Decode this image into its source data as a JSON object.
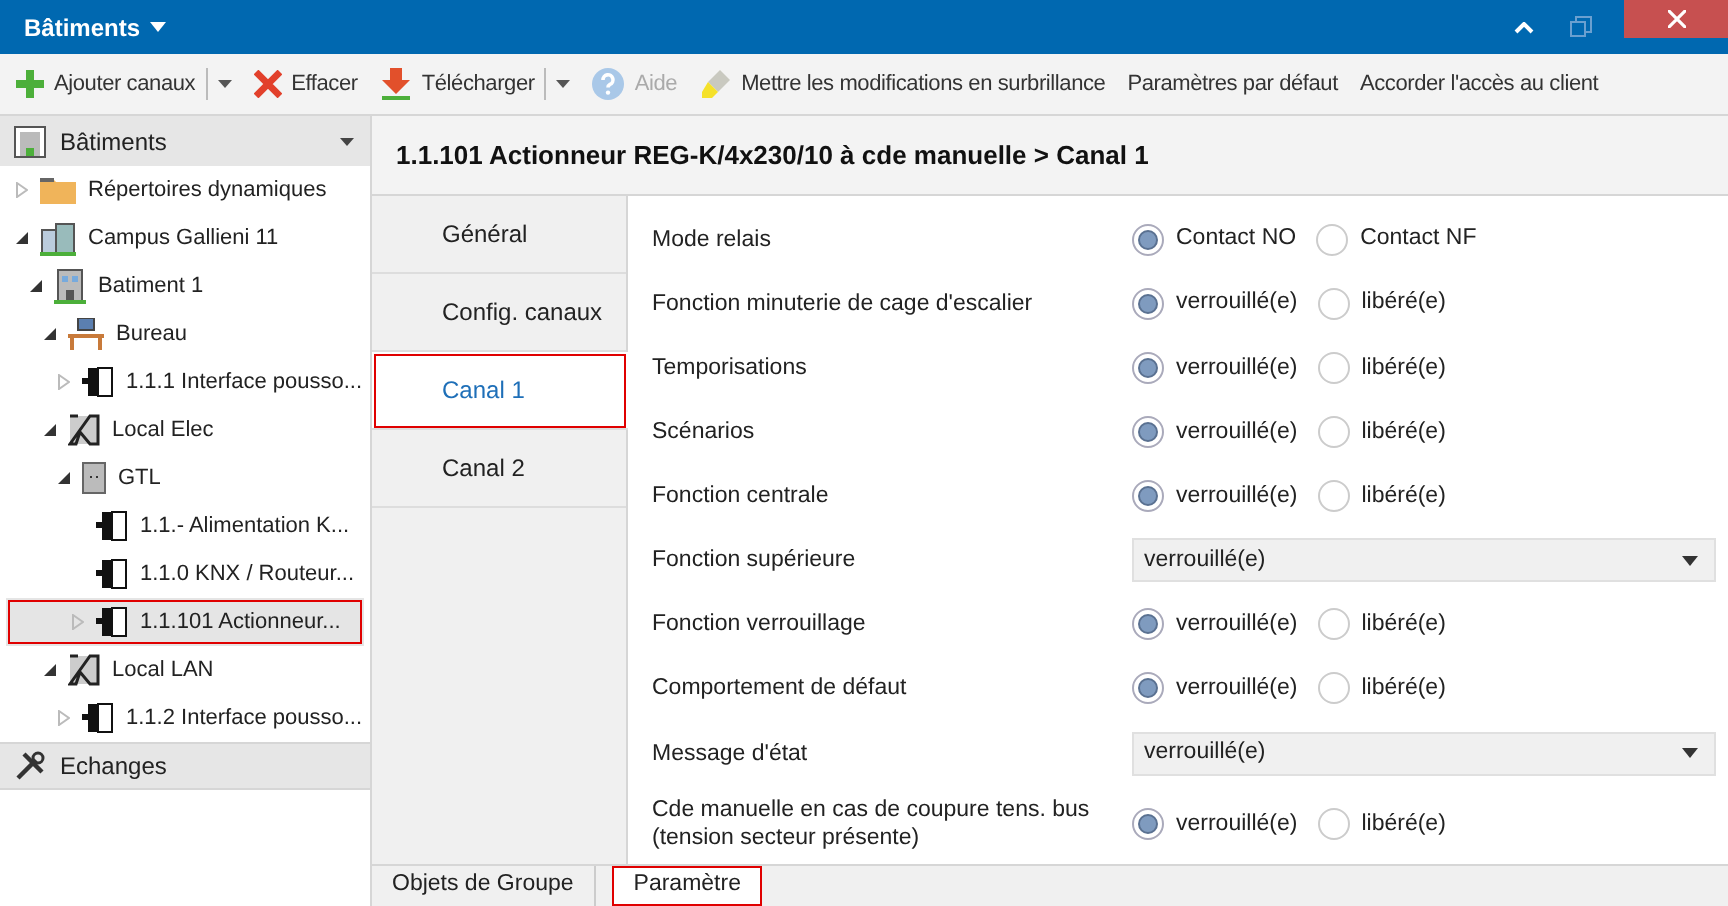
{
  "window": {
    "title": "Bâtiments"
  },
  "toolbar": [
    {
      "kind": "add",
      "label": "Ajouter canaux",
      "split": true,
      "disabled": false
    },
    {
      "kind": "delete",
      "label": "Effacer",
      "split": false,
      "disabled": false
    },
    {
      "kind": "download",
      "label": "Télécharger",
      "split": true,
      "disabled": false
    },
    {
      "kind": "help",
      "label": "Aide",
      "split": false,
      "disabled": true
    },
    {
      "kind": "highlight",
      "label": "Mettre les modifications en surbrillance",
      "split": false,
      "disabled": false
    },
    {
      "kind": "text",
      "label": "Paramètres par défaut",
      "split": false,
      "disabled": false
    },
    {
      "kind": "text",
      "label": "Accorder l'accès au client",
      "split": false,
      "disabled": false
    }
  ],
  "sidebar": {
    "header": "Bâtiments",
    "tree": [
      {
        "kind": "folder",
        "label": "Répertoires dynamiques",
        "expanded": false,
        "selected": false
      },
      {
        "kind": "campus",
        "label": "Campus Gallieni 11",
        "expanded": true,
        "selected": false,
        "children": [
          {
            "kind": "building",
            "label": "Batiment 1",
            "expanded": true,
            "selected": false,
            "children": [
              {
                "kind": "office",
                "label": "Bureau",
                "expanded": true,
                "selected": false,
                "children": [
                  {
                    "kind": "device",
                    "label": "1.1.1 Interface pousso...",
                    "expanded": false,
                    "selected": false
                  }
                ]
              },
              {
                "kind": "room",
                "label": "Local Elec",
                "expanded": true,
                "selected": false,
                "children": [
                  {
                    "kind": "cabinet",
                    "label": "GTL",
                    "expanded": true,
                    "selected": false,
                    "children": [
                      {
                        "kind": "device",
                        "label": "1.1.- Alimentation K...",
                        "selected": false
                      },
                      {
                        "kind": "device",
                        "label": "1.1.0 KNX / Routeur...",
                        "selected": false
                      },
                      {
                        "kind": "device",
                        "label": "1.1.101 Actionneur...",
                        "expanded": false,
                        "selected": true
                      }
                    ]
                  }
                ]
              },
              {
                "kind": "room",
                "label": "Local LAN",
                "expanded": true,
                "selected": false,
                "children": [
                  {
                    "kind": "device",
                    "label": "1.1.2 Interface pousso...",
                    "expanded": false,
                    "selected": false
                  }
                ]
              }
            ]
          }
        ]
      }
    ],
    "footer": "Echanges"
  },
  "content": {
    "title": "1.1.101 Actionneur REG-K/4x230/10 à cde manuelle > Canal 1",
    "tabs": [
      {
        "label": "Général",
        "selected": false
      },
      {
        "label": "Config. canaux",
        "selected": false
      },
      {
        "label": "Canal 1",
        "selected": true
      },
      {
        "label": "Canal 2",
        "selected": false
      }
    ],
    "parameters": [
      {
        "kind": "radio",
        "label": "Mode relais",
        "options": [
          {
            "label": "Contact NO",
            "selected": true
          },
          {
            "label": "Contact NF",
            "selected": false
          }
        ]
      },
      {
        "kind": "radio",
        "label": "Fonction minuterie de cage d'escalier",
        "options": [
          {
            "label": "verrouillé(e)",
            "selected": true
          },
          {
            "label": "libéré(e)",
            "selected": false
          }
        ]
      },
      {
        "kind": "radio",
        "label": "Temporisations",
        "options": [
          {
            "label": "verrouillé(e)",
            "selected": true
          },
          {
            "label": "libéré(e)",
            "selected": false
          }
        ]
      },
      {
        "kind": "radio",
        "label": "Scénarios",
        "options": [
          {
            "label": "verrouillé(e)",
            "selected": true
          },
          {
            "label": "libéré(e)",
            "selected": false
          }
        ]
      },
      {
        "kind": "radio",
        "label": "Fonction centrale",
        "options": [
          {
            "label": "verrouillé(e)",
            "selected": true
          },
          {
            "label": "libéré(e)",
            "selected": false
          }
        ]
      },
      {
        "kind": "select",
        "label": "Fonction supérieure",
        "value": "verrouillé(e)"
      },
      {
        "kind": "radio",
        "label": "Fonction verrouillage",
        "options": [
          {
            "label": "verrouillé(e)",
            "selected": true
          },
          {
            "label": "libéré(e)",
            "selected": false
          }
        ]
      },
      {
        "kind": "radio",
        "label": "Comportement de défaut",
        "options": [
          {
            "label": "verrouillé(e)",
            "selected": true
          },
          {
            "label": "libéré(e)",
            "selected": false
          }
        ]
      },
      {
        "kind": "select",
        "label": "Message d'état",
        "value": "verrouillé(e)"
      },
      {
        "kind": "radio",
        "label": "Cde manuelle en cas de coupure tens. bus\n(tension secteur présente)",
        "options": [
          {
            "label": "verrouillé(e)",
            "selected": true
          },
          {
            "label": "libéré(e)",
            "selected": false
          }
        ]
      }
    ],
    "bottom_tabs": [
      {
        "label": "Objets de Groupe",
        "selected": false
      },
      {
        "label": "Paramètre",
        "selected": true
      }
    ]
  }
}
